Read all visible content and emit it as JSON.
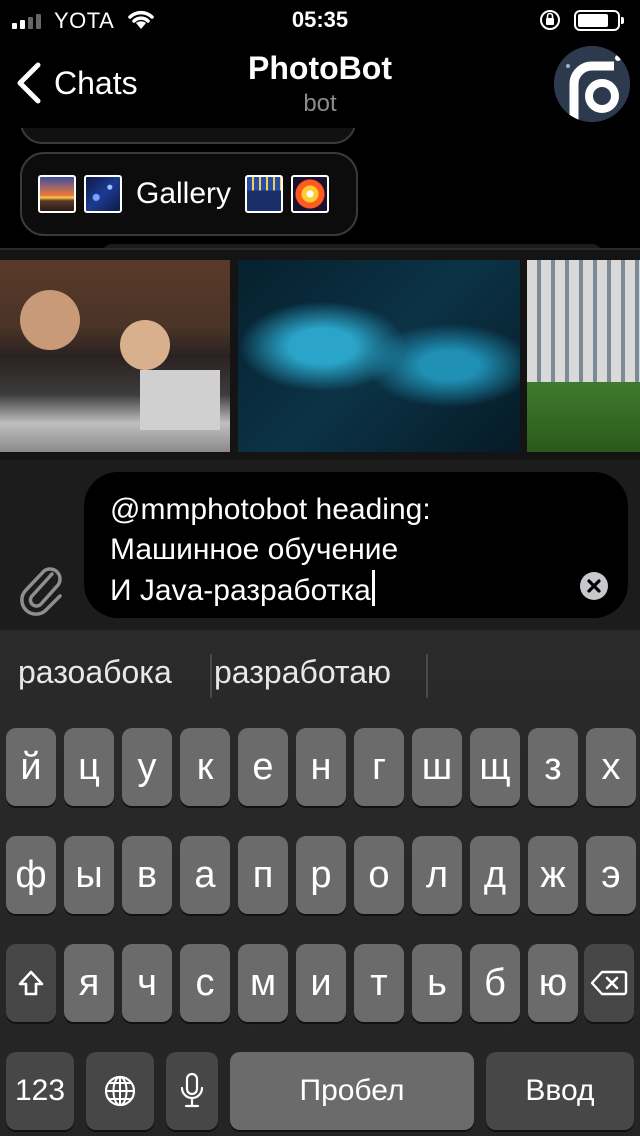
{
  "status_bar": {
    "carrier": "YOTA",
    "time": "05:35",
    "battery_level": 0.85
  },
  "nav": {
    "back_label": "Chats",
    "title": "PhotoBot",
    "subtitle": "bot"
  },
  "chat": {
    "gallery_button_label": "Gallery",
    "gallery_emojis": [
      "sunrise-over-mountains",
      "milky-way",
      "night-city",
      "fireworks"
    ]
  },
  "results": {
    "thumbnails": [
      {
        "name": "people-at-laptops-photo"
      },
      {
        "name": "digital-hands-network-photo"
      },
      {
        "name": "building-photo"
      }
    ]
  },
  "input": {
    "lines": [
      "@mmphotobot heading:",
      "Машинное обучение",
      "И Java-разработка"
    ]
  },
  "keyboard": {
    "suggestions": [
      "разоабока",
      "разработаю"
    ],
    "row1": [
      "й",
      "ц",
      "у",
      "к",
      "е",
      "н",
      "г",
      "ш",
      "щ",
      "з",
      "х"
    ],
    "row2": [
      "ф",
      "ы",
      "в",
      "а",
      "п",
      "р",
      "о",
      "л",
      "д",
      "ж",
      "э"
    ],
    "row3": [
      "я",
      "ч",
      "с",
      "м",
      "и",
      "т",
      "ь",
      "б",
      "ю"
    ],
    "numbers_label": "123",
    "space_label": "Пробел",
    "return_label": "Ввод",
    "icons": {
      "shift": "shift-icon",
      "backspace": "backspace-icon",
      "globe": "globe-icon",
      "mic": "microphone-icon"
    }
  }
}
